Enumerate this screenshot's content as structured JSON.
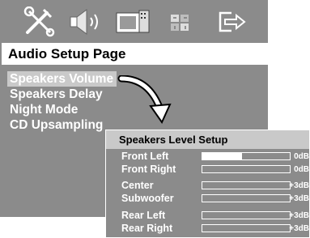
{
  "icons": [
    {
      "name": "general-setup-icon"
    },
    {
      "name": "audio-setup-icon"
    },
    {
      "name": "video-setup-icon"
    },
    {
      "name": "preference-setup-icon"
    },
    {
      "name": "exit-icon"
    }
  ],
  "page_title": "Audio Setup Page",
  "menu": {
    "items": [
      {
        "label": "Speakers Volume",
        "selected": true
      },
      {
        "label": "Speakers Delay",
        "selected": false
      },
      {
        "label": "Night Mode",
        "selected": false
      },
      {
        "label": "CD Upsampling",
        "selected": false
      }
    ]
  },
  "popup": {
    "title": "Speakers Level Setup",
    "rows": [
      {
        "label": "Front Left",
        "value": "0dB",
        "level": 0.45
      },
      {
        "label": "Front Right",
        "value": "0dB",
        "level": 0
      },
      {
        "label": "Center",
        "value": "+3dB",
        "level": 0
      },
      {
        "label": "Subwoofer",
        "value": "+3dB",
        "level": 0
      },
      {
        "label": "Rear Left",
        "value": "+3dB",
        "level": 0
      },
      {
        "label": "Rear Right",
        "value": "+3dB",
        "level": 0
      }
    ]
  },
  "colors": {
    "panel": "#8b8b8b",
    "highlight": "#c9c9c9",
    "text": "#ffffff",
    "title_bg": "#ffffff"
  }
}
